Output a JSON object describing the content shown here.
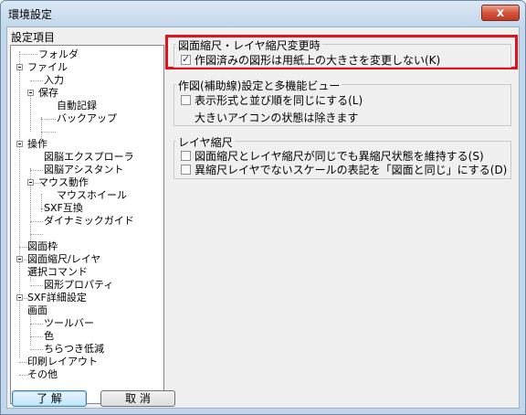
{
  "window": {
    "title": "環境設定",
    "close_glyph": "x"
  },
  "tree": {
    "label": "設定項目",
    "items": [
      {
        "label": "フォルダ"
      },
      {
        "label": "ファイル"
      },
      {
        "label": "入力"
      },
      {
        "label": "保存"
      },
      {
        "label": "自動記録"
      },
      {
        "label": "バックアップ"
      },
      {
        "label": "操作"
      },
      {
        "label": "図脳エクスプローラ"
      },
      {
        "label": "図脳アシスタント"
      },
      {
        "label": "マウス動作"
      },
      {
        "label": "マウスホイール"
      },
      {
        "label": "SXF互換"
      },
      {
        "label": "ダイナミックガイド"
      },
      {
        "label": "図面枠"
      },
      {
        "label": "図面縮尺/レイヤ"
      },
      {
        "label": "選択コマンド"
      },
      {
        "label": "図形プロパティ"
      },
      {
        "label": "SXF詳細設定"
      },
      {
        "label": "画面"
      },
      {
        "label": "ツールバー"
      },
      {
        "label": "色"
      },
      {
        "label": "ちらつき低減"
      },
      {
        "label": "印刷レイアウト"
      },
      {
        "label": "その他"
      }
    ]
  },
  "groups": {
    "scale_change": {
      "title": "図面縮尺・レイヤ縮尺変更時",
      "option": {
        "label": "作図済みの図形は用紙上の大きさを変更しない(K)",
        "checked": true
      }
    },
    "multi_view": {
      "title": "作図(補助線)設定と多機能ビュー",
      "option": {
        "label": "表示形式と並び順を同じにする(L)",
        "checked": false
      },
      "note": "大きいアイコンの状態は除きます"
    },
    "layer_scale": {
      "title": "レイヤ縮尺",
      "options": [
        {
          "label": "図面縮尺とレイヤ縮尺が同じでも異縮尺状態を維持する(S)",
          "checked": false
        },
        {
          "label": "異縮尺レイヤでないスケールの表記を「図面と同じ」にする(D)",
          "checked": false
        }
      ]
    }
  },
  "buttons": {
    "ok": "了 解",
    "cancel": "取 消"
  },
  "colors": {
    "highlight": "#e3111b",
    "titlebar": "#c3d6ea"
  }
}
